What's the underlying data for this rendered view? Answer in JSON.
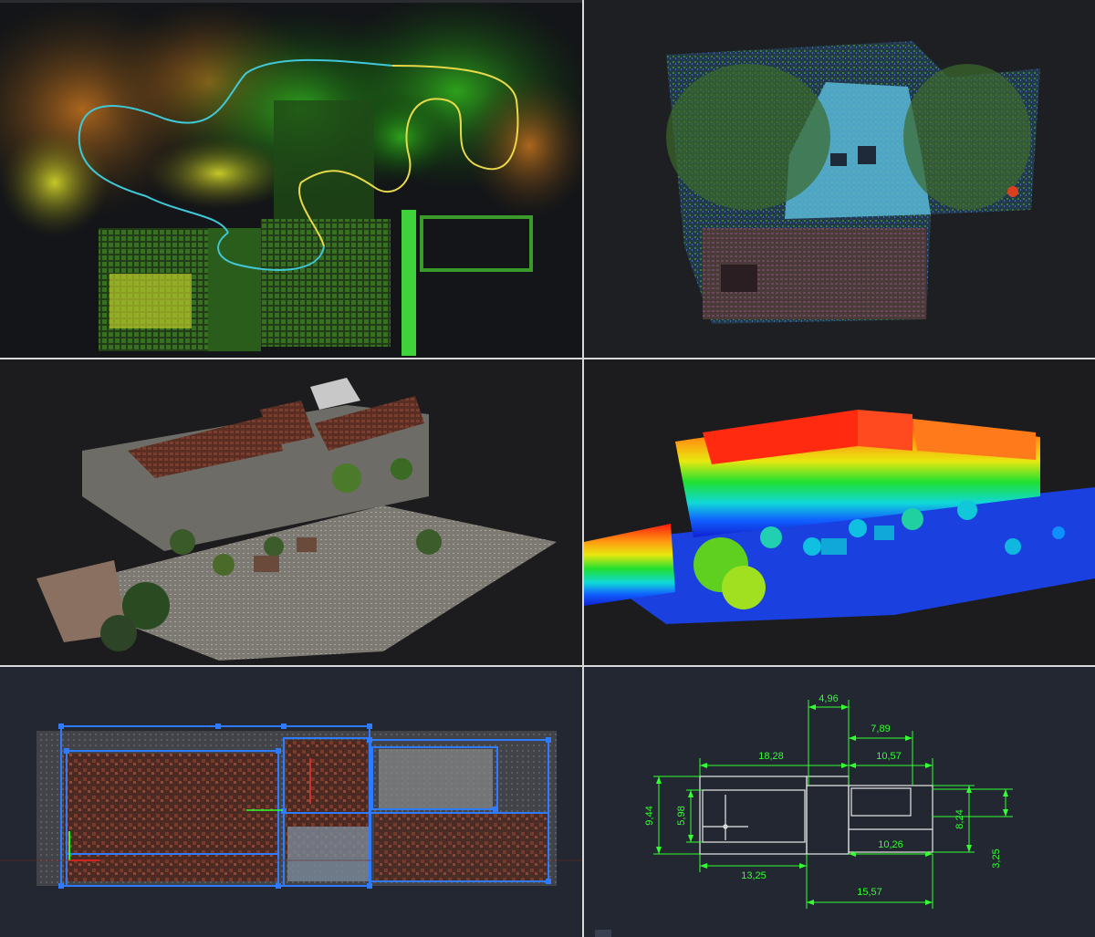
{
  "panels": [
    {
      "id": "p1",
      "name": "topdown-scan-trajectory"
    },
    {
      "id": "p2",
      "name": "topdown-intensity-view"
    },
    {
      "id": "p3",
      "name": "perspective-rgb-view"
    },
    {
      "id": "p4",
      "name": "perspective-elevation-view"
    },
    {
      "id": "p5",
      "name": "floorplan-overlay-view"
    },
    {
      "id": "p6",
      "name": "cad-dimension-drawing"
    }
  ],
  "dimensions": {
    "d1": "4,96",
    "d2": "7,89",
    "d3": "18,28",
    "d4": "10,57",
    "d5": "9,44",
    "d6": "5,98",
    "d7": "8,24",
    "d8": "13,25",
    "d9": "10,26",
    "d10": "3,25",
    "d11": "15,57"
  },
  "colors": {
    "dimension_green": "#33ff33",
    "trajectory_cyan": "#3fc8d8",
    "trajectory_yellow": "#e8d84a",
    "plan_blue": "#2f7bff"
  }
}
